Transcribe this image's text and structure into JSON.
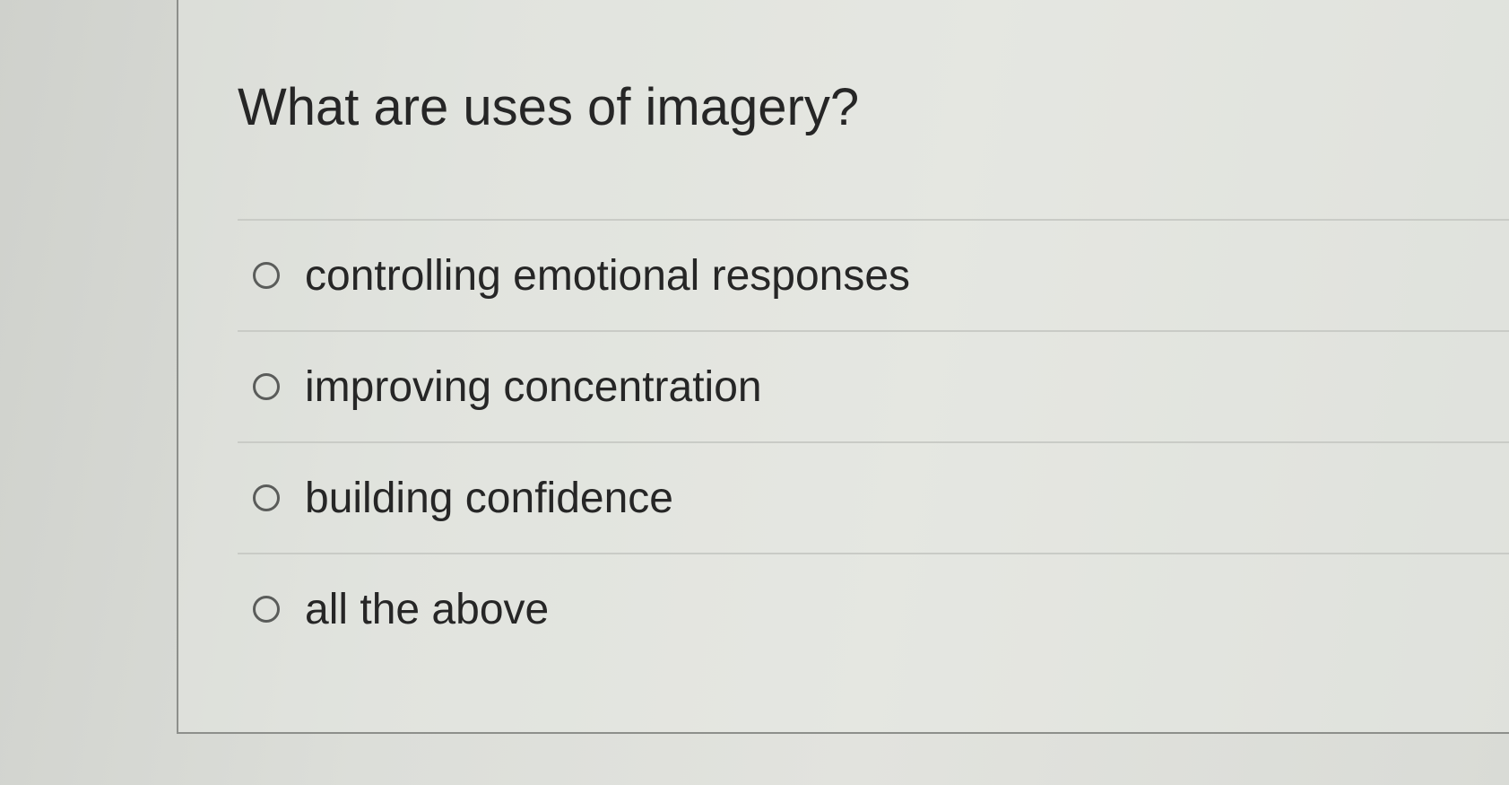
{
  "question": {
    "text": "What are uses of imagery?"
  },
  "answers": [
    {
      "label": "controlling emotional responses",
      "selected": false
    },
    {
      "label": "improving concentration",
      "selected": false
    },
    {
      "label": "building confidence",
      "selected": false
    },
    {
      "label": "all the above",
      "selected": false
    }
  ]
}
